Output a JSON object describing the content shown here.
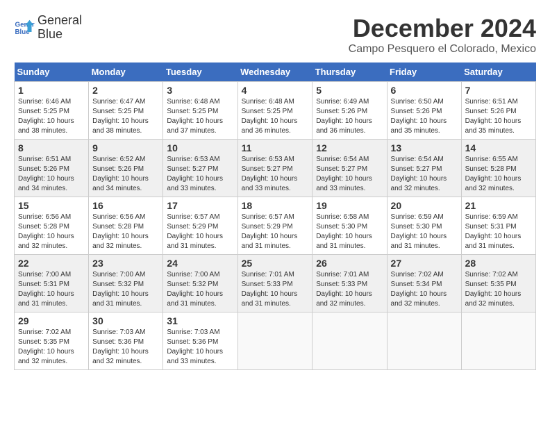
{
  "header": {
    "logo_line1": "General",
    "logo_line2": "Blue",
    "month_title": "December 2024",
    "location": "Campo Pesquero el Colorado, Mexico"
  },
  "calendar": {
    "days_of_week": [
      "Sunday",
      "Monday",
      "Tuesday",
      "Wednesday",
      "Thursday",
      "Friday",
      "Saturday"
    ],
    "weeks": [
      [
        {
          "day": "",
          "info": ""
        },
        {
          "day": "2",
          "info": "Sunrise: 6:47 AM\nSunset: 5:25 PM\nDaylight: 10 hours\nand 38 minutes."
        },
        {
          "day": "3",
          "info": "Sunrise: 6:48 AM\nSunset: 5:25 PM\nDaylight: 10 hours\nand 37 minutes."
        },
        {
          "day": "4",
          "info": "Sunrise: 6:48 AM\nSunset: 5:25 PM\nDaylight: 10 hours\nand 36 minutes."
        },
        {
          "day": "5",
          "info": "Sunrise: 6:49 AM\nSunset: 5:26 PM\nDaylight: 10 hours\nand 36 minutes."
        },
        {
          "day": "6",
          "info": "Sunrise: 6:50 AM\nSunset: 5:26 PM\nDaylight: 10 hours\nand 35 minutes."
        },
        {
          "day": "7",
          "info": "Sunrise: 6:51 AM\nSunset: 5:26 PM\nDaylight: 10 hours\nand 35 minutes."
        }
      ],
      [
        {
          "day": "1",
          "info": "Sunrise: 6:46 AM\nSunset: 5:25 PM\nDaylight: 10 hours\nand 38 minutes."
        },
        {
          "day": "9",
          "info": "Sunrise: 6:52 AM\nSunset: 5:26 PM\nDaylight: 10 hours\nand 34 minutes."
        },
        {
          "day": "10",
          "info": "Sunrise: 6:53 AM\nSunset: 5:27 PM\nDaylight: 10 hours\nand 33 minutes."
        },
        {
          "day": "11",
          "info": "Sunrise: 6:53 AM\nSunset: 5:27 PM\nDaylight: 10 hours\nand 33 minutes."
        },
        {
          "day": "12",
          "info": "Sunrise: 6:54 AM\nSunset: 5:27 PM\nDaylight: 10 hours\nand 33 minutes."
        },
        {
          "day": "13",
          "info": "Sunrise: 6:54 AM\nSunset: 5:27 PM\nDaylight: 10 hours\nand 32 minutes."
        },
        {
          "day": "14",
          "info": "Sunrise: 6:55 AM\nSunset: 5:28 PM\nDaylight: 10 hours\nand 32 minutes."
        }
      ],
      [
        {
          "day": "8",
          "info": "Sunrise: 6:51 AM\nSunset: 5:26 PM\nDaylight: 10 hours\nand 34 minutes."
        },
        {
          "day": "16",
          "info": "Sunrise: 6:56 AM\nSunset: 5:28 PM\nDaylight: 10 hours\nand 32 minutes."
        },
        {
          "day": "17",
          "info": "Sunrise: 6:57 AM\nSunset: 5:29 PM\nDaylight: 10 hours\nand 31 minutes."
        },
        {
          "day": "18",
          "info": "Sunrise: 6:57 AM\nSunset: 5:29 PM\nDaylight: 10 hours\nand 31 minutes."
        },
        {
          "day": "19",
          "info": "Sunrise: 6:58 AM\nSunset: 5:30 PM\nDaylight: 10 hours\nand 31 minutes."
        },
        {
          "day": "20",
          "info": "Sunrise: 6:59 AM\nSunset: 5:30 PM\nDaylight: 10 hours\nand 31 minutes."
        },
        {
          "day": "21",
          "info": "Sunrise: 6:59 AM\nSunset: 5:31 PM\nDaylight: 10 hours\nand 31 minutes."
        }
      ],
      [
        {
          "day": "15",
          "info": "Sunrise: 6:56 AM\nSunset: 5:28 PM\nDaylight: 10 hours\nand 32 minutes."
        },
        {
          "day": "23",
          "info": "Sunrise: 7:00 AM\nSunset: 5:32 PM\nDaylight: 10 hours\nand 31 minutes."
        },
        {
          "day": "24",
          "info": "Sunrise: 7:00 AM\nSunset: 5:32 PM\nDaylight: 10 hours\nand 31 minutes."
        },
        {
          "day": "25",
          "info": "Sunrise: 7:01 AM\nSunset: 5:33 PM\nDaylight: 10 hours\nand 31 minutes."
        },
        {
          "day": "26",
          "info": "Sunrise: 7:01 AM\nSunset: 5:33 PM\nDaylight: 10 hours\nand 32 minutes."
        },
        {
          "day": "27",
          "info": "Sunrise: 7:02 AM\nSunset: 5:34 PM\nDaylight: 10 hours\nand 32 minutes."
        },
        {
          "day": "28",
          "info": "Sunrise: 7:02 AM\nSunset: 5:35 PM\nDaylight: 10 hours\nand 32 minutes."
        }
      ],
      [
        {
          "day": "22",
          "info": "Sunrise: 7:00 AM\nSunset: 5:31 PM\nDaylight: 10 hours\nand 31 minutes."
        },
        {
          "day": "30",
          "info": "Sunrise: 7:03 AM\nSunset: 5:36 PM\nDaylight: 10 hours\nand 32 minutes."
        },
        {
          "day": "31",
          "info": "Sunrise: 7:03 AM\nSunset: 5:36 PM\nDaylight: 10 hours\nand 33 minutes."
        },
        {
          "day": "",
          "info": ""
        },
        {
          "day": "",
          "info": ""
        },
        {
          "day": "",
          "info": ""
        },
        {
          "day": ""
        }
      ],
      [
        {
          "day": "29",
          "info": "Sunrise: 7:02 AM\nSunset: 5:35 PM\nDaylight: 10 hours\nand 32 minutes."
        },
        {
          "day": "",
          "info": ""
        },
        {
          "day": "",
          "info": ""
        },
        {
          "day": "",
          "info": ""
        },
        {
          "day": "",
          "info": ""
        },
        {
          "day": "",
          "info": ""
        },
        {
          "day": "",
          "info": ""
        }
      ]
    ]
  }
}
